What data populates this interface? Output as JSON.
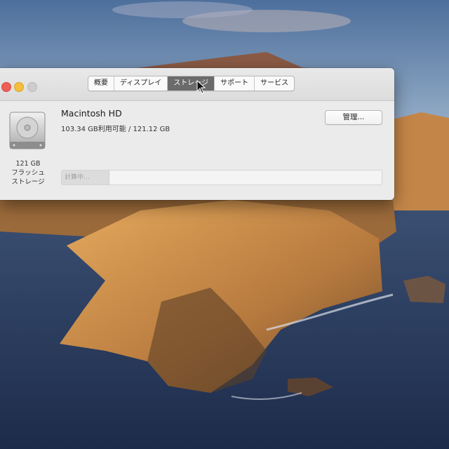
{
  "window": {
    "tabs": [
      {
        "label": "概要",
        "active": false
      },
      {
        "label": "ディスプレイ",
        "active": false
      },
      {
        "label": "ストレージ",
        "active": true
      },
      {
        "label": "サポート",
        "active": false
      },
      {
        "label": "サービス",
        "active": false
      }
    ]
  },
  "disk": {
    "icon": "hard-drive-icon",
    "size": "121 GB",
    "kind_line1": "フラッシュ",
    "kind_line2": "ストレージ",
    "name": "Macintosh HD",
    "availability": "103.34 GB利用可能 / 121.12 GB",
    "manage_label": "管理...",
    "status": "計算中...",
    "used_fraction": 0.1466
  },
  "colors": {
    "close": "#ee5e55",
    "minimize": "#f3bf3a",
    "zoom": "#cdcdcd",
    "active_tab": "#6b6b6b"
  }
}
